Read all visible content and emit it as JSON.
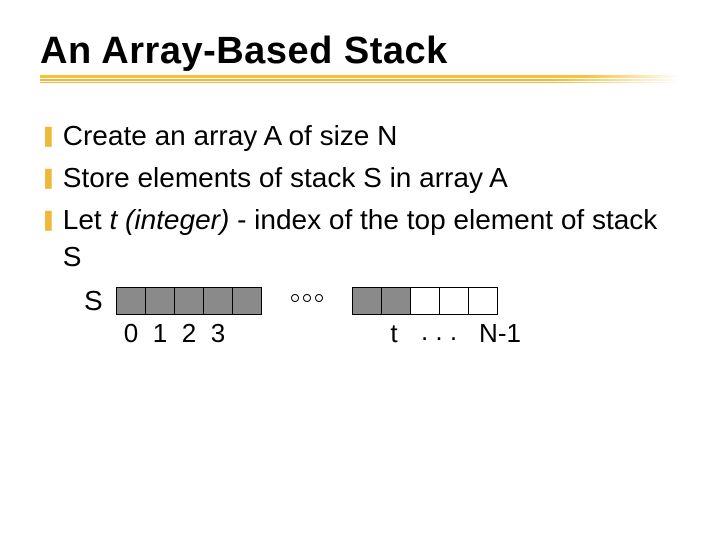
{
  "title": "An Array-Based Stack",
  "bullets": {
    "b1": "Create an array A of size N",
    "b2": "Store elements of stack S in array A",
    "b3_pre": "Let ",
    "b3_ital": "t (integer)",
    "b3_post": " - index of the top element of stack S"
  },
  "diagram": {
    "s_label": "S",
    "idx0": "0",
    "idx1": "1",
    "idx2": "2",
    "idx3": "3",
    "t_label": "t",
    "ellipsis": ". . .",
    "n_minus_1": "N-1"
  }
}
